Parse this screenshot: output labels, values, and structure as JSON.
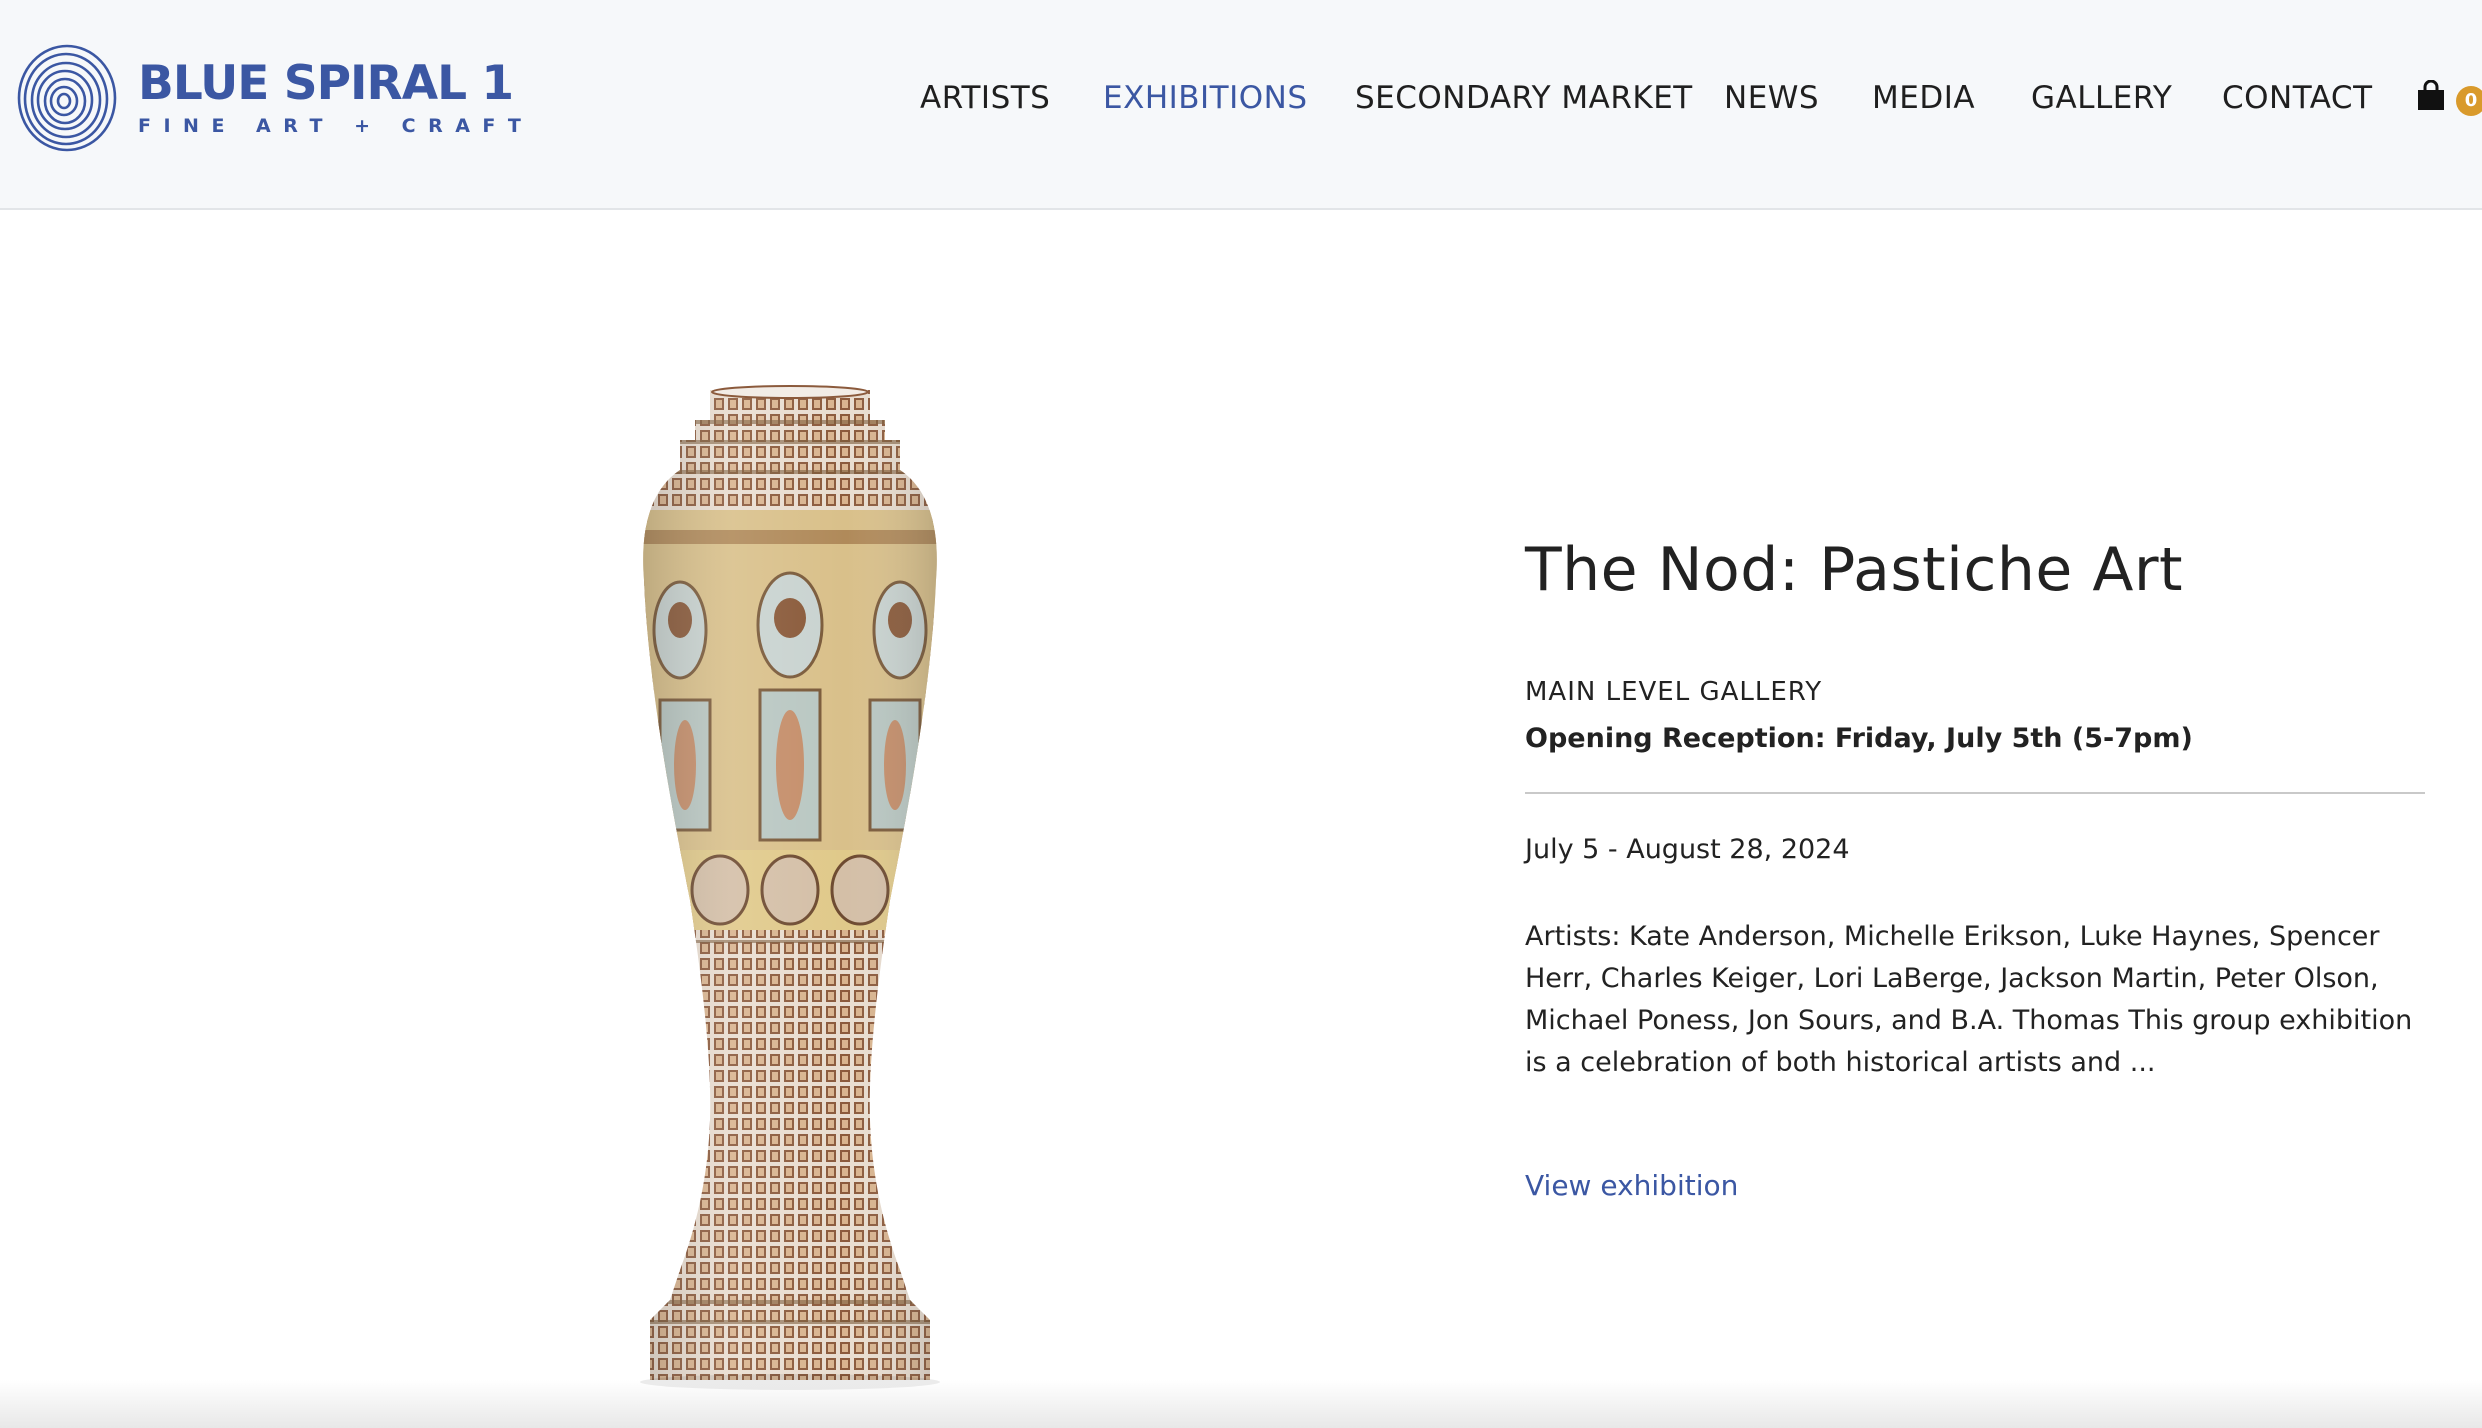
{
  "site": {
    "logo_name": "BLUE SPIRAL 1",
    "logo_tagline": "FINE ART + CRAFT",
    "brand_color": "#3b57a3"
  },
  "nav": {
    "items": [
      {
        "label": "ARTISTS",
        "active": false
      },
      {
        "label": "EXHIBITIONS",
        "active": true
      },
      {
        "label": "SECONDARY MARKET",
        "active": false
      },
      {
        "label": "NEWS",
        "active": false
      },
      {
        "label": "MEDIA",
        "active": false
      },
      {
        "label": "GALLERY",
        "active": false
      },
      {
        "label": "CONTACT",
        "active": false
      }
    ],
    "cart_icon": "shopping-bag-icon",
    "cart_count": "0",
    "cart_badge_color": "#d99a2b"
  },
  "exhibition": {
    "title": "The Nod: Pastiche Art",
    "location": "MAIN LEVEL GALLERY",
    "reception": "Opening Reception: Friday, July 5th (5-7pm)",
    "dates": "July 5 - August 28, 2024",
    "description": "Artists: Kate Anderson, Michelle Erikson, Luke Haynes, Spencer Herr, Charles Keiger, Lori LaBerge, Jackson Martin, Peter Olson, Michael Poness, Jon Sours, and  B.A. Thomas This group exhibition is a celebration of both historical artists and ...",
    "view_link": "View exhibition"
  }
}
